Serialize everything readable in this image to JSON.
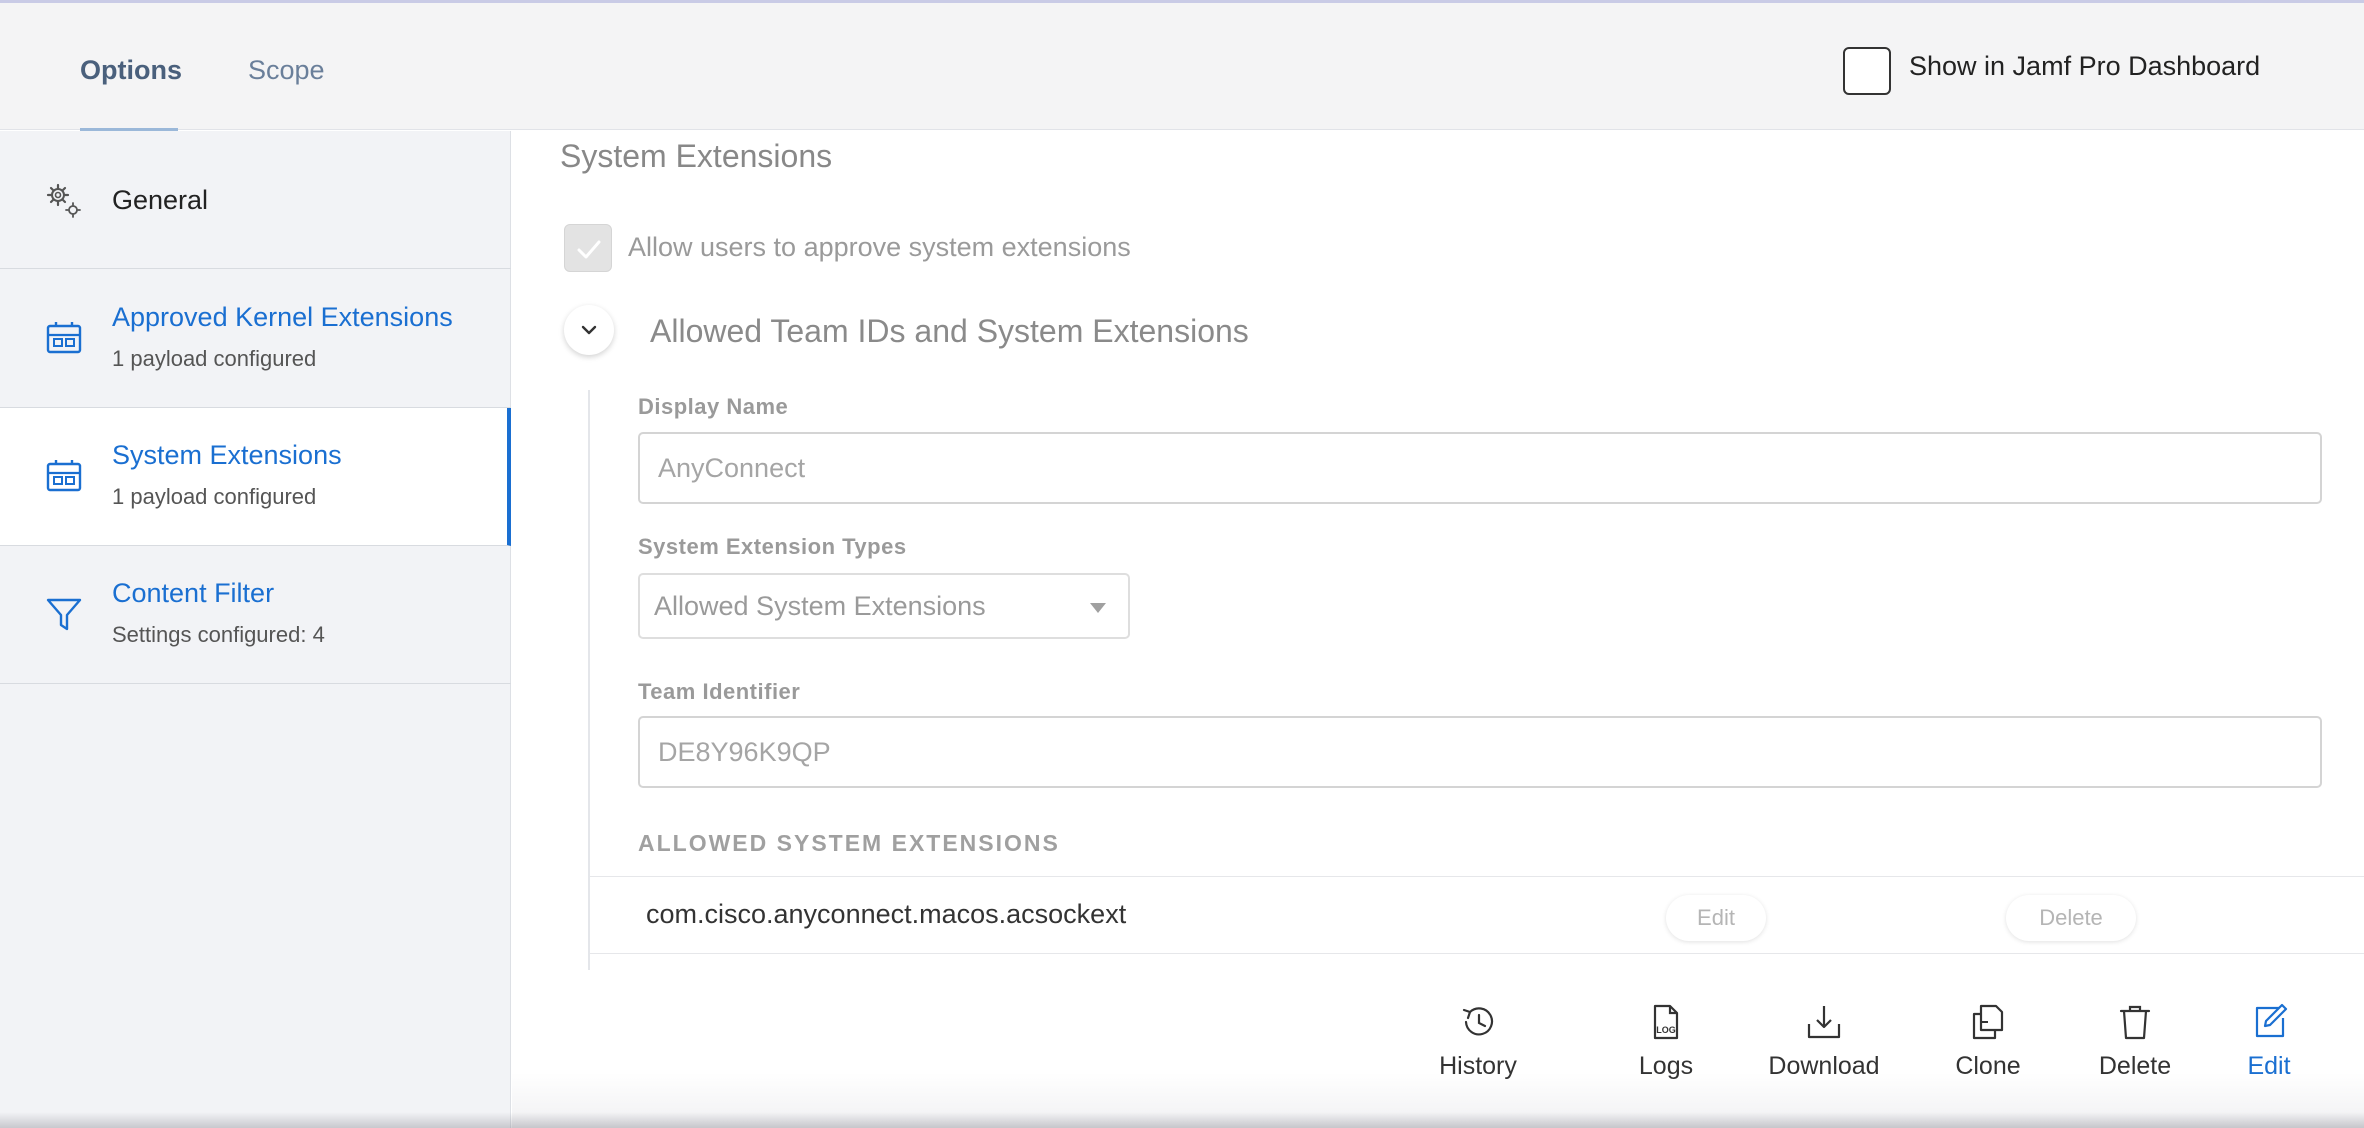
{
  "header": {
    "tabs": [
      {
        "label": "Options"
      },
      {
        "label": "Scope"
      }
    ],
    "dashboard_checkbox_label": "Show in Jamf Pro Dashboard"
  },
  "sidebar": {
    "items": [
      {
        "title": "General",
        "subtitle": "",
        "icon": "gear-icon"
      },
      {
        "title": "Approved Kernel Extensions",
        "subtitle": "1 payload configured",
        "icon": "extension-icon"
      },
      {
        "title": "System Extensions",
        "subtitle": "1 payload configured",
        "icon": "extension-icon"
      },
      {
        "title": "Content Filter",
        "subtitle": "Settings configured: 4",
        "icon": "filter-icon"
      }
    ]
  },
  "main": {
    "section_title": "System Extensions",
    "allow_users_label": "Allow users to approve system extensions",
    "group_title": "Allowed Team IDs and System Extensions",
    "display_name_label": "Display Name",
    "display_name_value": "AnyConnect",
    "types_label": "System Extension Types",
    "types_value": "Allowed System Extensions",
    "team_id_label": "Team Identifier",
    "team_id_value": "DE8Y96K9QP",
    "list_header": "ALLOWED SYSTEM EXTENSIONS",
    "list_rows": [
      {
        "identifier": "com.cisco.anyconnect.macos.acsockext",
        "edit_label": "Edit",
        "delete_label": "Delete"
      }
    ]
  },
  "footer": {
    "buttons": [
      {
        "label": "History",
        "icon": "history-icon"
      },
      {
        "label": "Logs",
        "icon": "logs-icon",
        "icon_text": "LOG"
      },
      {
        "label": "Download",
        "icon": "download-icon"
      },
      {
        "label": "Clone",
        "icon": "clone-icon"
      },
      {
        "label": "Delete",
        "icon": "trash-icon"
      },
      {
        "label": "Edit",
        "icon": "edit-icon"
      }
    ]
  },
  "colors": {
    "accent": "#1a6fd1",
    "sidebar_bg": "#f2f3f6",
    "header_bg": "#f4f4f5"
  }
}
